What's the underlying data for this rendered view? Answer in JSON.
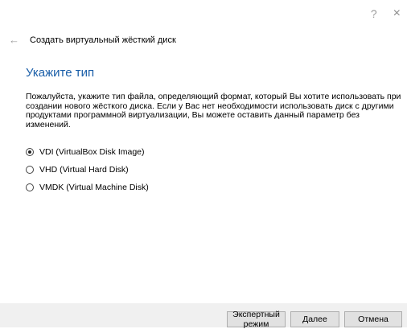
{
  "window": {
    "help_icon": "?",
    "close_icon": "×"
  },
  "header": {
    "back_icon": "←",
    "title": "Создать виртуальный жёсткий диск"
  },
  "section": {
    "title": "Укажите тип",
    "description": "Пожалуйста, укажите тип файла, определяющий формат, который Вы хотите использовать при создании нового жёсткого диска. Если у Вас нет необходимости использовать диск с другими продуктами программной виртуализации, Вы можете оставить данный параметр без изменений."
  },
  "options": [
    {
      "label": "VDI (VirtualBox Disk Image)",
      "checked": true
    },
    {
      "label": "VHD (Virtual Hard Disk)",
      "checked": false
    },
    {
      "label": "VMDK (Virtual Machine Disk)",
      "checked": false
    }
  ],
  "buttons": {
    "expert": "Экспертный режим",
    "next": "Далее",
    "cancel": "Отмена"
  },
  "colors": {
    "accent": "#1a5ea8",
    "footer_bg": "#f0f0f0"
  }
}
